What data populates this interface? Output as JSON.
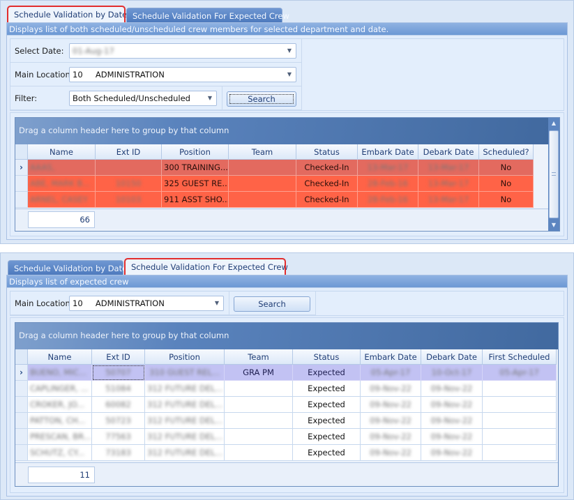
{
  "panel_by_date": {
    "tabs": [
      {
        "label": "Schedule Validation by Date",
        "active": true,
        "highlighted": true
      },
      {
        "label": "Schedule Validation For Expected Crew",
        "active": false,
        "highlighted": false
      }
    ],
    "description": "Displays list of both scheduled/unscheduled crew members for selected department and date.",
    "select_date": {
      "label": "Select Date:",
      "value": "01-Aug-17"
    },
    "main_location": {
      "label": "Main Location:",
      "value": "10     ADMINISTRATION"
    },
    "filter": {
      "label": "Filter:",
      "value": "Both Scheduled/Unscheduled"
    },
    "search_label": "Search",
    "grid": {
      "group_panel_text": "Drag a column header here to group by that column",
      "columns": [
        "Name",
        "Ext ID",
        "Position",
        "Team",
        "Status",
        "Embark Date",
        "Debark Date",
        "Scheduled?"
      ],
      "rows": [
        {
          "name": "AAAS,",
          "ext_id": "",
          "position": "300 TRAINING...",
          "team": "",
          "status": "Checked-In",
          "embark": "13-Mar-17",
          "debark": "13-Mar-17",
          "scheduled": "No",
          "current": true
        },
        {
          "name": "ABE, MARK B...",
          "ext_id": "10150",
          "position": "325 GUEST RE...",
          "team": "",
          "status": "Checked-In",
          "embark": "28-Feb-16",
          "debark": "13-Mar-17",
          "scheduled": "No",
          "current": false
        },
        {
          "name": "ARNEL, CASEY",
          "ext_id": "10103",
          "position": "911 ASST SHO...",
          "team": "",
          "status": "Checked-In",
          "embark": "28-Feb-16",
          "debark": "13-Mar-17",
          "scheduled": "No",
          "current": false
        }
      ],
      "row_count": "66",
      "row_colors": {
        "current": "#e36a5f",
        "normal": "#ff6347"
      }
    }
  },
  "panel_expected": {
    "tabs": [
      {
        "label": "Schedule Validation by Date",
        "active": false,
        "highlighted": false
      },
      {
        "label": "Schedule Validation For Expected Crew",
        "active": true,
        "highlighted": true
      }
    ],
    "description": "Displays list of expected crew",
    "main_location": {
      "label": "Main Location:",
      "value": "10     ADMINISTRATION"
    },
    "search_label": "Search",
    "grid": {
      "group_panel_text": "Drag a column header here to group by that column",
      "columns": [
        "Name",
        "Ext ID",
        "Position",
        "Team",
        "Status",
        "Embark Date",
        "Debark Date",
        "First Scheduled"
      ],
      "rows": [
        {
          "name": "BUENO, MIC...",
          "ext_id": "50707",
          "position": "310 GUEST REL...",
          "team": "GRA PM",
          "status": "Expected",
          "embark": "05-Apr-17",
          "debark": "10-Oct-17",
          "first_scheduled": "05-Apr-17",
          "current": true
        },
        {
          "name": "CAPLINGER, ...",
          "ext_id": "51084",
          "position": "312 FUTURE DEL...",
          "team": "",
          "status": "Expected",
          "embark": "09-Nov-22",
          "debark": "09-Nov-22",
          "first_scheduled": "",
          "current": false
        },
        {
          "name": "CROKER, JO...",
          "ext_id": "60082",
          "position": "312 FUTURE DEL...",
          "team": "",
          "status": "Expected",
          "embark": "09-Nov-22",
          "debark": "09-Nov-22",
          "first_scheduled": "",
          "current": false
        },
        {
          "name": "PATTON, CH...",
          "ext_id": "50723",
          "position": "312 FUTURE DEL...",
          "team": "",
          "status": "Expected",
          "embark": "09-Nov-22",
          "debark": "09-Nov-22",
          "first_scheduled": "",
          "current": false
        },
        {
          "name": "PRESCAN, BR...",
          "ext_id": "77563",
          "position": "312 FUTURE DEL...",
          "team": "",
          "status": "Expected",
          "embark": "09-Nov-22",
          "debark": "09-Nov-22",
          "first_scheduled": "",
          "current": false
        },
        {
          "name": "SCHUTZ, CY...",
          "ext_id": "73183",
          "position": "312 FUTURE DEL...",
          "team": "",
          "status": "Expected",
          "embark": "09-Nov-22",
          "debark": "09-Nov-22",
          "first_scheduled": "",
          "current": false
        }
      ],
      "row_count": "11",
      "selected_row_color": "#c2c2f3"
    }
  },
  "colors": {
    "highlight_outline": "#e22d2d",
    "tab_inactive": "#4c79bd",
    "group_panel": "#41699f"
  },
  "icons": {
    "dropdown_arrow": "▼",
    "row_indicator": "›",
    "scroll_up": "▲",
    "scroll_down": "▼"
  }
}
